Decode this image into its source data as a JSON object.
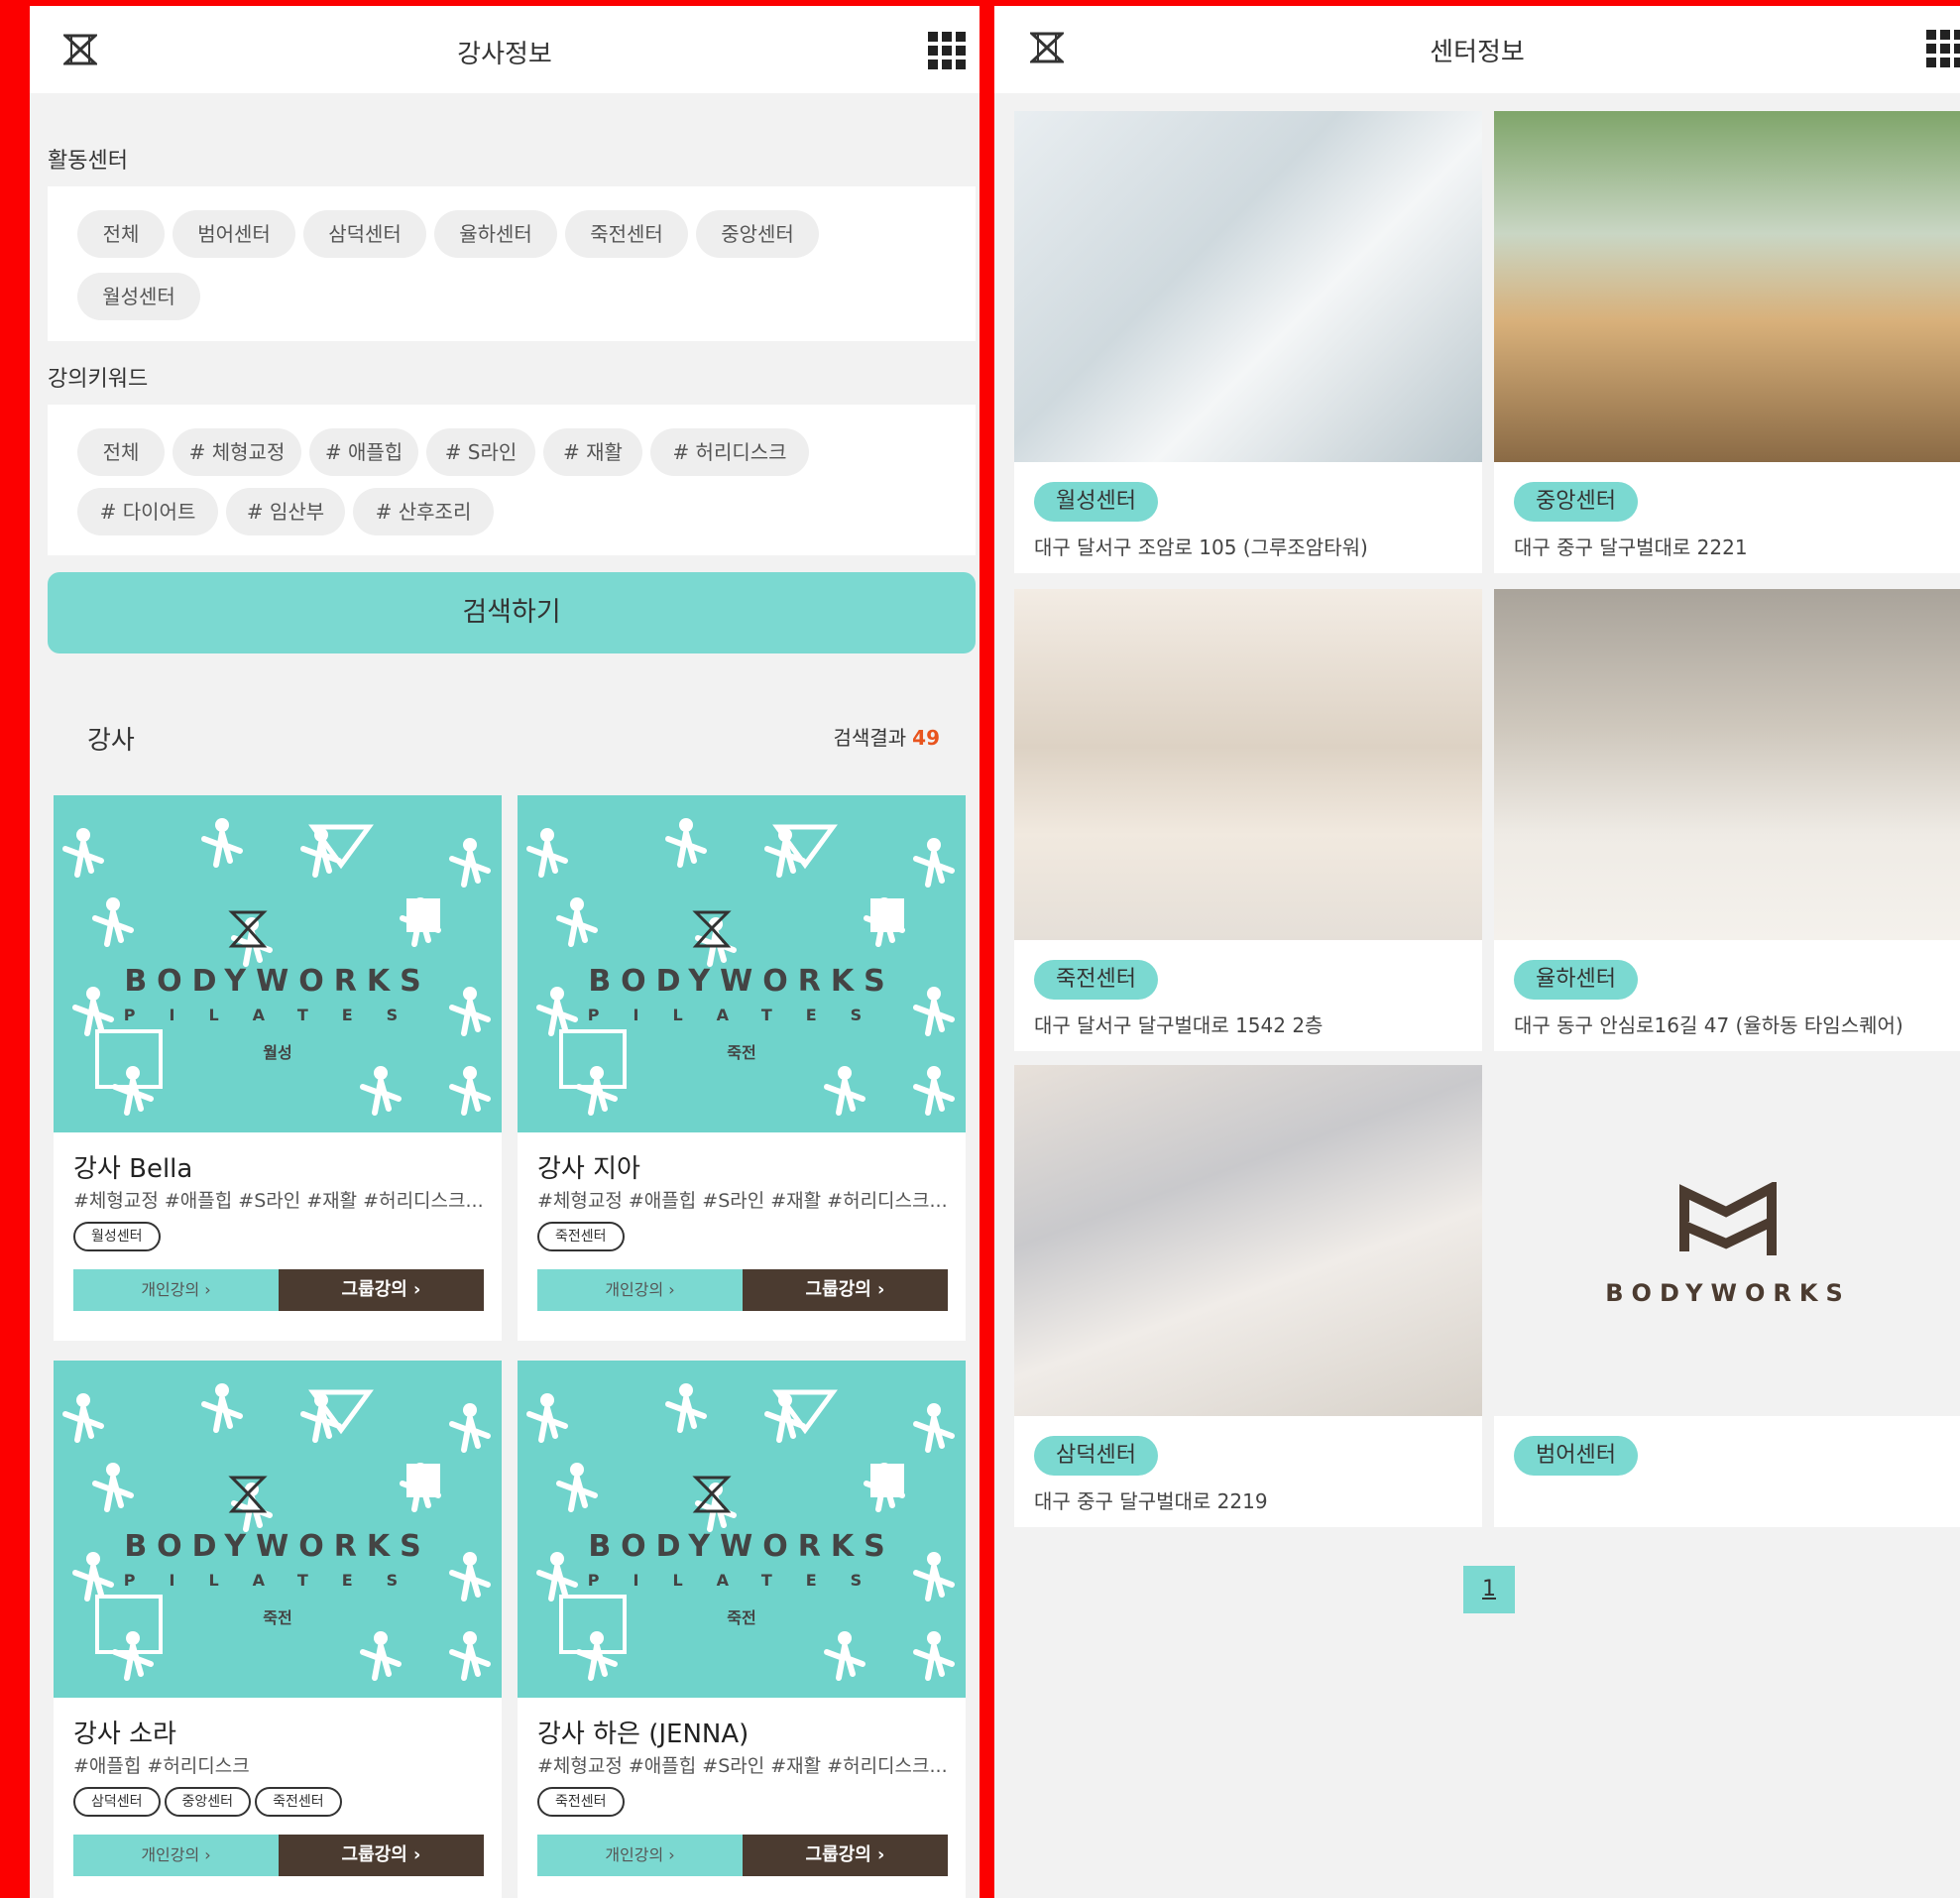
{
  "left": {
    "header_title": "강사정보",
    "center_section_label": "활동센터",
    "center_chips": [
      "전체",
      "범어센터",
      "삼덕센터",
      "율하센터",
      "죽전센터",
      "중앙센터",
      "월성센터"
    ],
    "keyword_section_label": "강의키워드",
    "keyword_chips": [
      "전체",
      "# 체형교정",
      "# 애플힙",
      "# S라인",
      "# 재활",
      "# 허리디스크",
      "# 다이어트",
      "# 임산부",
      "# 산후조리"
    ],
    "search_button": "검색하기",
    "instructor_label": "강사",
    "result_label": "검색결과",
    "result_count": "49",
    "poster_brand": "BODYWORKS",
    "poster_sub": "PILATES",
    "personal_btn": "개인강의 ›",
    "group_btn": "그룹강의 ›",
    "cards": [
      {
        "name": "강사 Bella",
        "tags": "#체형교정 #애플힙 #S라인 #재활 #허리디스크...",
        "centers": [
          "월성센터"
        ],
        "poster_center": "월성"
      },
      {
        "name": "강사 지아",
        "tags": "#체형교정 #애플힙 #S라인 #재활 #허리디스크...",
        "centers": [
          "죽전센터"
        ],
        "poster_center": "죽전"
      },
      {
        "name": "강사 소라",
        "tags": "#애플힙 #허리디스크",
        "centers": [
          "삼덕센터",
          "중앙센터",
          "죽전센터"
        ],
        "poster_center": "죽전"
      },
      {
        "name": "강사 하은 (JENNA)",
        "tags": "#체형교정 #애플힙 #S라인 #재활 #허리디스크...",
        "centers": [
          "죽전센터"
        ],
        "poster_center": "죽전"
      }
    ]
  },
  "right": {
    "header_title": "센터정보",
    "logo_text": "BODYWORKS",
    "centers": [
      {
        "name": "월성센터",
        "address": "대구 달서구 조암로 105 (그루조암타워)"
      },
      {
        "name": "중앙센터",
        "address": "대구 중구 달구벌대로 2221"
      },
      {
        "name": "죽전센터",
        "address": "대구 달서구 달구벌대로 1542 2층"
      },
      {
        "name": "율하센터",
        "address": "대구 동구 안심로16길 47 (율하동 타임스퀘어)"
      },
      {
        "name": "삼덕센터",
        "address": "대구 중구 달구벌대로 2219"
      },
      {
        "name": "범어센터",
        "address": ""
      }
    ],
    "page": "1"
  },
  "colors": {
    "accent": "#7bd9d1",
    "dark": "#4b3b30",
    "frame": "#fc0000",
    "highlight": "#e8541e"
  }
}
